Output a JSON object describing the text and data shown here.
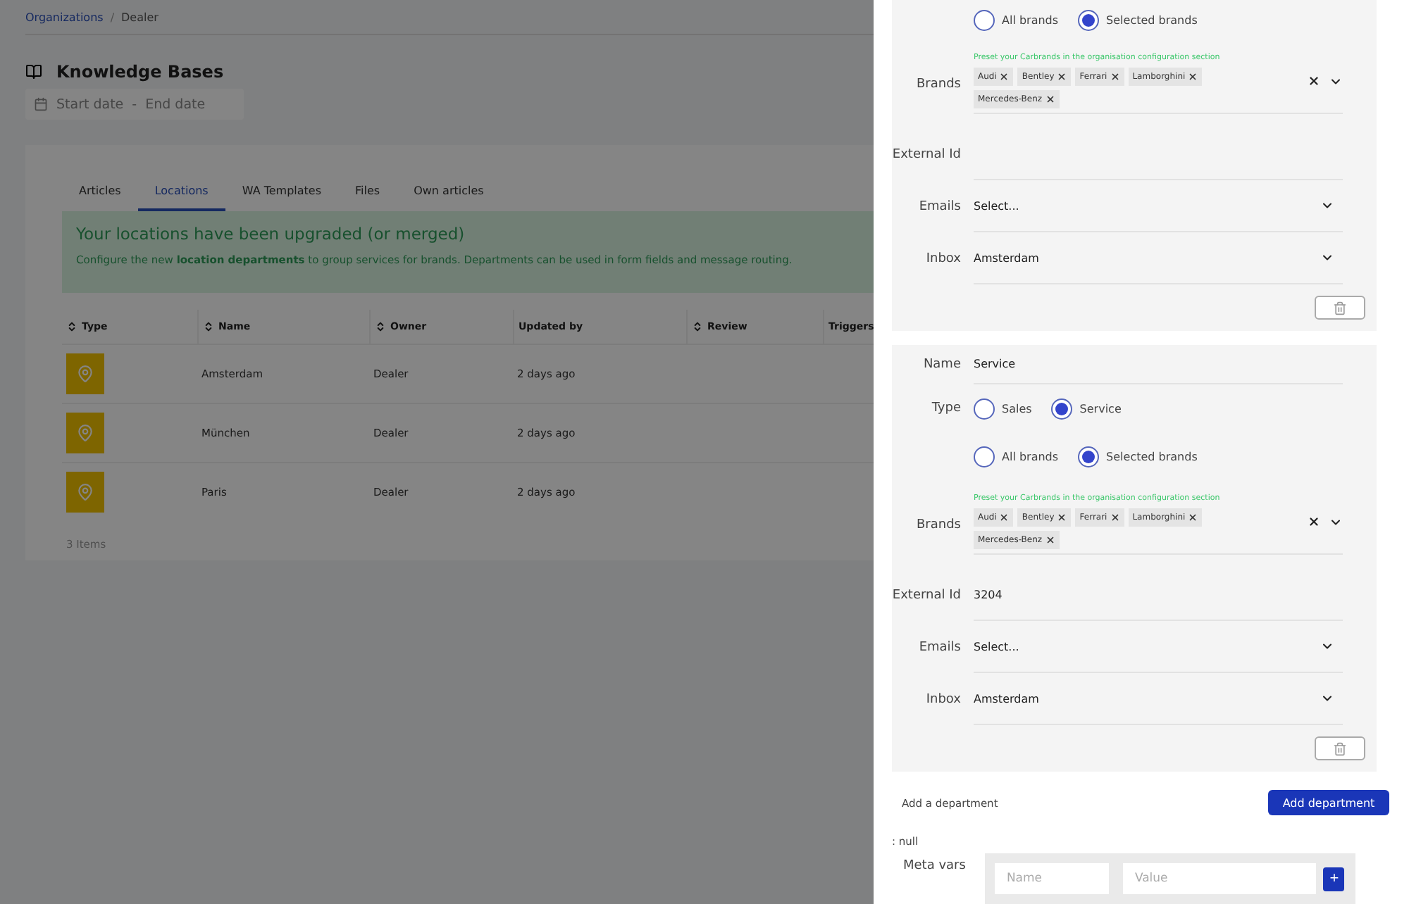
{
  "breadcrumb": [
    {
      "label": "Organizations",
      "link": true
    },
    {
      "label": "Dealer",
      "link": false
    }
  ],
  "breadcrumb_separator": "/",
  "page": {
    "title": "Knowledge Bases",
    "date_range": {
      "start_placeholder": "Start date",
      "separator": "-",
      "end_placeholder": "End date"
    }
  },
  "tabs": [
    {
      "label": "Articles",
      "selected": false
    },
    {
      "label": "Locations",
      "selected": true
    },
    {
      "label": "WA Templates",
      "selected": false
    },
    {
      "label": "Files",
      "selected": false
    },
    {
      "label": "Own articles",
      "selected": false
    }
  ],
  "alert": {
    "title": "Your locations have been upgraded (or merged)",
    "message": "Configure the new **location departments** to group services for brands. Departments can be used in form fields and message routing."
  },
  "table": {
    "columns": [
      {
        "label": "Type",
        "sortable": true
      },
      {
        "label": "Name",
        "sortable": true
      },
      {
        "label": "Owner",
        "sortable": true
      },
      {
        "label": "Updated by",
        "sortable": false
      },
      {
        "label": "Review",
        "sortable": true
      },
      {
        "label": "Triggers",
        "sortable": false
      }
    ],
    "rows": [
      {
        "name": "Amsterdam",
        "owner": "Dealer",
        "updated_by": "2 days ago"
      },
      {
        "name": "München",
        "owner": "Dealer",
        "updated_by": "2 days ago"
      },
      {
        "name": "Paris",
        "owner": "Dealer",
        "updated_by": "2 days ago"
      }
    ],
    "footer": "3 Items"
  },
  "departments": [
    {
      "fields": [
        {
          "kind": "radio",
          "options": [
            {
              "label": "All brands",
              "selected": false
            },
            {
              "label": "Selected brands",
              "selected": true
            }
          ]
        },
        {
          "kind": "tags",
          "label": "Brands",
          "hint": "Preset your Carbrands in the organisation configuration section",
          "tags": [
            "Audi",
            "Bentley",
            "Ferrari",
            "Lamborghini",
            "Mercedes-Benz"
          ]
        },
        {
          "kind": "text",
          "label": "External Id"
        },
        {
          "kind": "select",
          "label": "Emails",
          "placeholder": "Select..."
        },
        {
          "kind": "select",
          "label": "Inbox",
          "value": "Amsterdam"
        }
      ]
    },
    {
      "fields": [
        {
          "kind": "text",
          "label": "Name",
          "value": "Service"
        },
        {
          "kind": "radio",
          "label": "Type",
          "options": [
            {
              "label": "Sales",
              "selected": false
            },
            {
              "label": "Service",
              "selected": true
            }
          ]
        },
        {
          "kind": "radio",
          "options": [
            {
              "label": "All brands",
              "selected": false
            },
            {
              "label": "Selected brands",
              "selected": true
            }
          ]
        },
        {
          "kind": "tags",
          "label": "Brands",
          "hint": "Preset your Carbrands in the organisation configuration section",
          "tags": [
            "Audi",
            "Bentley",
            "Ferrari",
            "Lamborghini",
            "Mercedes-Benz"
          ]
        },
        {
          "kind": "text",
          "label": "External Id",
          "value": "3204"
        },
        {
          "kind": "select",
          "label": "Emails",
          "placeholder": "Select..."
        },
        {
          "kind": "select",
          "label": "Inbox",
          "value": "Amsterdam"
        }
      ]
    }
  ],
  "add_department": {
    "label": "Add a department",
    "button": "Add department"
  },
  "null_text": ": null",
  "meta_vars": {
    "label": "Meta vars",
    "name_placeholder": "Name",
    "value_placeholder": "Value",
    "add": "+"
  }
}
